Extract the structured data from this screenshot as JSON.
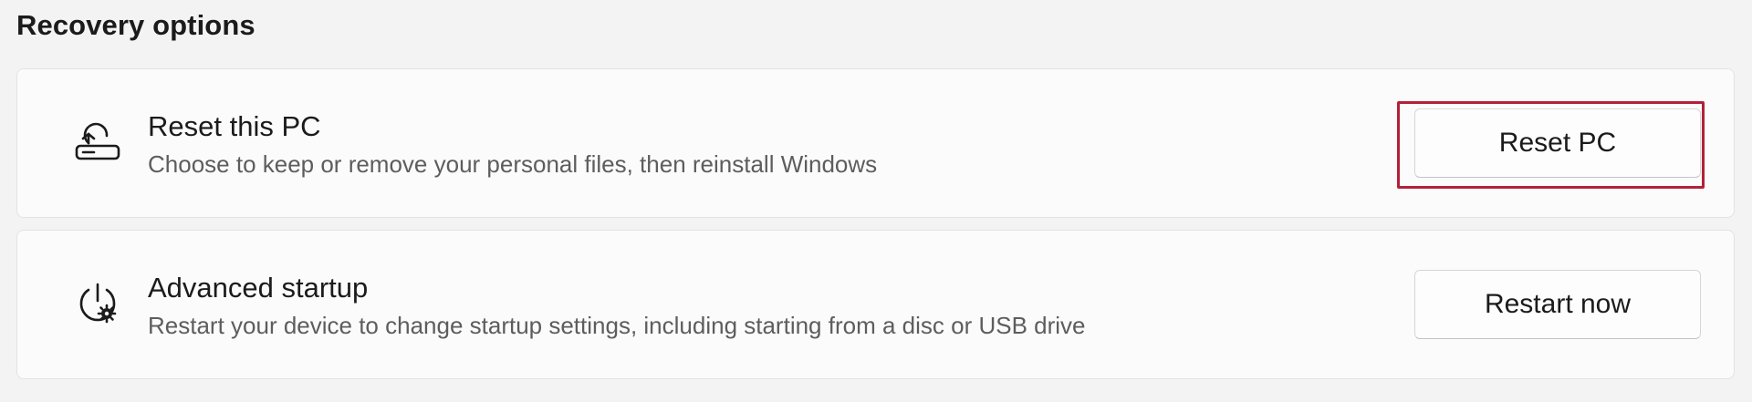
{
  "section": {
    "title": "Recovery options"
  },
  "options": [
    {
      "id": "reset",
      "icon": "reset-pc-icon",
      "title": "Reset this PC",
      "description": "Choose to keep or remove your personal files, then reinstall Windows",
      "button_label": "Reset PC",
      "highlighted": true
    },
    {
      "id": "advanced",
      "icon": "advanced-startup-icon",
      "title": "Advanced startup",
      "description": "Restart your device to change startup settings, including starting from a disc or USB drive",
      "button_label": "Restart now",
      "highlighted": false
    }
  ],
  "colors": {
    "background": "#f3f3f3",
    "card": "#fbfbfb",
    "highlight": "#b3203a"
  }
}
